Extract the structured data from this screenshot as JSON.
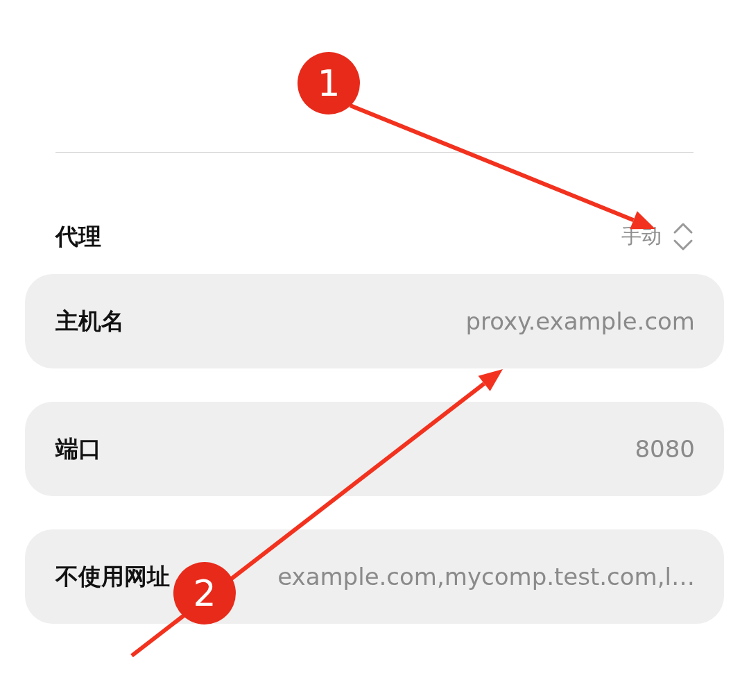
{
  "annotations": [
    {
      "number": "1"
    },
    {
      "number": "2"
    }
  ],
  "proxy": {
    "label": "代理",
    "mode": "手动"
  },
  "fields": [
    {
      "label": "主机名",
      "value": "proxy.example.com"
    },
    {
      "label": "端口",
      "value": "8080"
    },
    {
      "label": "不使用网址",
      "value": "example.com,mycomp.test.com,l…"
    }
  ]
}
